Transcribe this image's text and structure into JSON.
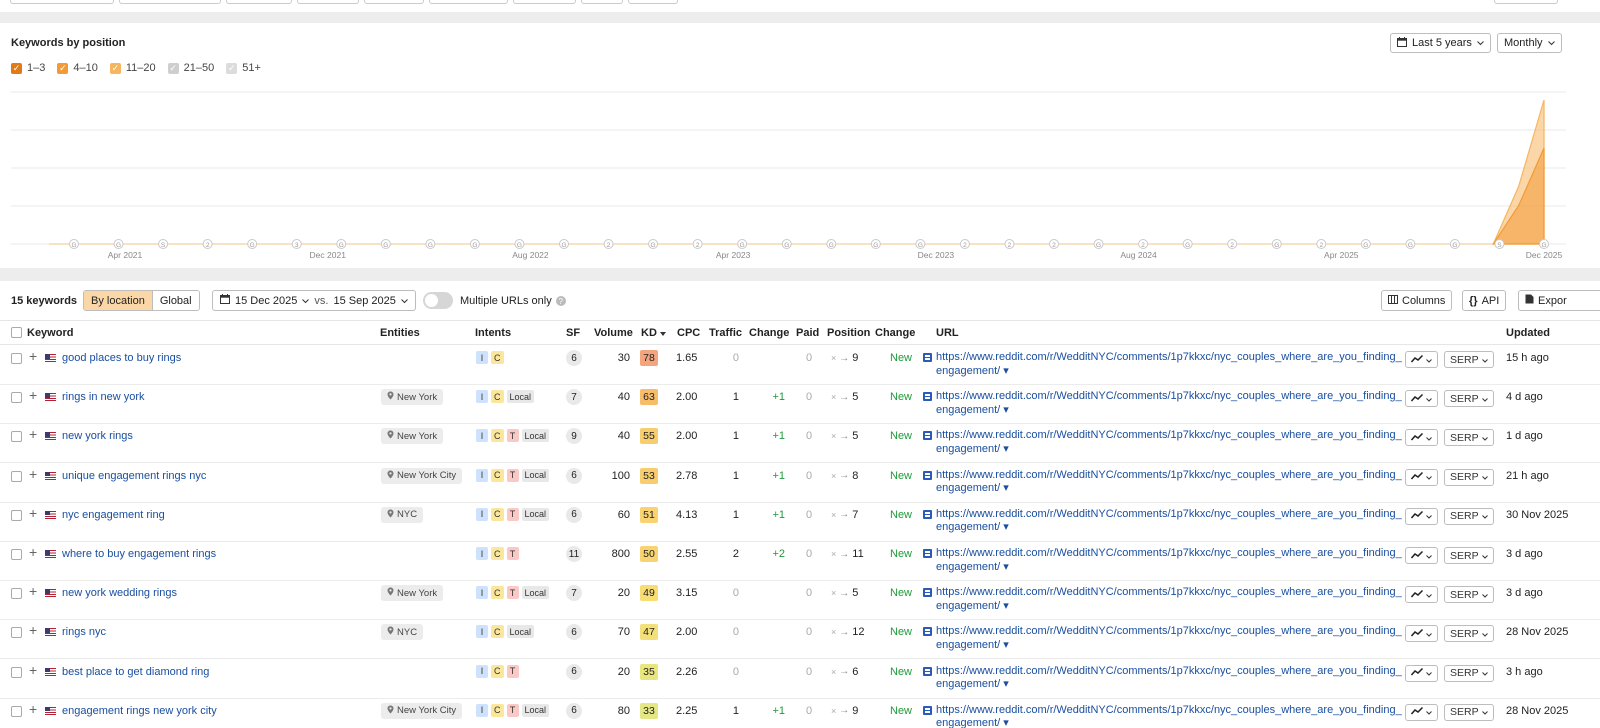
{
  "chart": {
    "title": "Keywords by position",
    "range_label": "Last 5 years",
    "granularity_label": "Monthly",
    "legend": [
      {
        "label": "1–3",
        "checked": true,
        "color": "#e07b18"
      },
      {
        "label": "4–10",
        "checked": true,
        "color": "#f29b34"
      },
      {
        "label": "11–20",
        "checked": true,
        "color": "#f7b560"
      },
      {
        "label": "21–50",
        "checked": true,
        "color": "#cfcfcf"
      },
      {
        "label": "51+",
        "checked": true,
        "color": "#dcdcdc"
      }
    ]
  },
  "chart_data": {
    "type": "area",
    "x_ticks": [
      "Apr 2021",
      "Dec 2021",
      "Aug 2022",
      "Apr 2023",
      "Dec 2023",
      "Aug 2024",
      "Apr 2025",
      "Dec 2025"
    ],
    "series": [
      {
        "name": "11–20",
        "color": "#f7b560",
        "x": [
          "Oct 2025",
          "Nov 2025",
          "Dec 2025"
        ],
        "values": [
          0,
          6,
          15
        ]
      },
      {
        "name": "4–10",
        "color": "#f29b34",
        "x": [
          "Oct 2025",
          "Nov 2025",
          "Dec 2025"
        ],
        "values": [
          0,
          4,
          10
        ]
      }
    ],
    "ylim": [
      0,
      15
    ],
    "grid": true,
    "annotation_markers": [
      "G",
      "G",
      "S",
      "2",
      "G",
      "3",
      "G",
      "G",
      "G",
      "G",
      "G",
      "G",
      "2",
      "G",
      "2",
      "G",
      "G",
      "G",
      "G",
      "G",
      "2",
      "2",
      "2",
      "G",
      "2",
      "G",
      "2",
      "G",
      "2",
      "G",
      "G",
      "G",
      "S",
      "G"
    ]
  },
  "toolbar": {
    "count": "15 keywords",
    "by_location": "By location",
    "global": "Global",
    "date_a": "15 Dec 2025",
    "vs": "vs.",
    "date_b": "15 Sep 2025",
    "multi_urls": "Multiple URLs only",
    "columns": "Columns",
    "api": "API",
    "export": "Expor"
  },
  "headers": {
    "keyword": "Keyword",
    "entities": "Entities",
    "intents": "Intents",
    "sf": "SF",
    "volume": "Volume",
    "kd": "KD",
    "cpc": "CPC",
    "traffic": "Traffic",
    "change": "Change",
    "paid": "Paid",
    "position": "Position",
    "change2": "Change",
    "url": "URL",
    "updated": "Updated"
  },
  "url_line1": "https://www.reddit.com/r/WedditNYC/comments/1p7kkxc/nyc_couples_where_are_you_finding_",
  "url_line2": "engagement/",
  "serp_label": "SERP",
  "rows": [
    {
      "keyword": "good places to buy rings",
      "entity": "",
      "intents": [
        "I",
        "C"
      ],
      "local": false,
      "sf": "6",
      "volume": "30",
      "kd": "78",
      "kd_color": "#f5a57e",
      "cpc": "1.65",
      "traffic": "0",
      "change": "",
      "paid": "0",
      "pos_from": "×",
      "pos_to": "9",
      "status": "New",
      "updated": "15 h ago"
    },
    {
      "keyword": "rings in new york",
      "entity": "New York",
      "intents": [
        "I",
        "C"
      ],
      "local": true,
      "sf": "7",
      "volume": "40",
      "kd": "63",
      "kd_color": "#f7bd68",
      "cpc": "2.00",
      "traffic": "1",
      "change": "+1",
      "paid": "0",
      "pos_from": "×",
      "pos_to": "5",
      "status": "New",
      "updated": "4 d ago"
    },
    {
      "keyword": "new york rings",
      "entity": "New York",
      "intents": [
        "I",
        "C",
        "T"
      ],
      "local": true,
      "sf": "9",
      "volume": "40",
      "kd": "55",
      "kd_color": "#f8cd6e",
      "cpc": "2.00",
      "traffic": "1",
      "change": "+1",
      "paid": "0",
      "pos_from": "×",
      "pos_to": "5",
      "status": "New",
      "updated": "1 d ago"
    },
    {
      "keyword": "unique engagement rings nyc",
      "entity": "New York City",
      "intents": [
        "I",
        "C",
        "T"
      ],
      "local": true,
      "sf": "6",
      "volume": "100",
      "kd": "53",
      "kd_color": "#f8cd6e",
      "cpc": "2.78",
      "traffic": "1",
      "change": "+1",
      "paid": "0",
      "pos_from": "×",
      "pos_to": "8",
      "status": "New",
      "updated": "21 h ago"
    },
    {
      "keyword": "nyc engagement ring",
      "entity": "NYC",
      "intents": [
        "I",
        "C",
        "T"
      ],
      "local": true,
      "sf": "6",
      "volume": "60",
      "kd": "51",
      "kd_color": "#f8d36f",
      "cpc": "4.13",
      "traffic": "1",
      "change": "+1",
      "paid": "0",
      "pos_from": "×",
      "pos_to": "7",
      "status": "New",
      "updated": "30 Nov 2025"
    },
    {
      "keyword": "where to buy engagement rings",
      "entity": "",
      "intents": [
        "I",
        "C",
        "T"
      ],
      "local": false,
      "sf": "11",
      "volume": "800",
      "kd": "50",
      "kd_color": "#f8d36f",
      "cpc": "2.55",
      "traffic": "2",
      "change": "+2",
      "paid": "0",
      "pos_from": "×",
      "pos_to": "11",
      "status": "New",
      "updated": "3 d ago"
    },
    {
      "keyword": "new york wedding rings",
      "entity": "New York",
      "intents": [
        "I",
        "C",
        "T"
      ],
      "local": true,
      "sf": "7",
      "volume": "20",
      "kd": "49",
      "kd_color": "#f7dd74",
      "cpc": "3.15",
      "traffic": "0",
      "change": "",
      "paid": "0",
      "pos_from": "×",
      "pos_to": "5",
      "status": "New",
      "updated": "3 d ago"
    },
    {
      "keyword": "rings nyc",
      "entity": "NYC",
      "intents": [
        "I",
        "C"
      ],
      "local": true,
      "sf": "6",
      "volume": "70",
      "kd": "47",
      "kd_color": "#f4e07a",
      "cpc": "2.00",
      "traffic": "0",
      "change": "",
      "paid": "0",
      "pos_from": "×",
      "pos_to": "12",
      "status": "New",
      "updated": "28 Nov 2025"
    },
    {
      "keyword": "best place to get diamond ring",
      "entity": "",
      "intents": [
        "I",
        "C",
        "T"
      ],
      "local": false,
      "sf": "6",
      "volume": "20",
      "kd": "35",
      "kd_color": "#e9e67e",
      "cpc": "2.26",
      "traffic": "0",
      "change": "",
      "paid": "0",
      "pos_from": "×",
      "pos_to": "6",
      "status": "New",
      "updated": "3 h ago"
    },
    {
      "keyword": "engagement rings new york city",
      "entity": "New York City",
      "intents": [
        "I",
        "C",
        "T"
      ],
      "local": true,
      "sf": "6",
      "volume": "80",
      "kd": "33",
      "kd_color": "#e4e783",
      "cpc": "2.25",
      "traffic": "1",
      "change": "+1",
      "paid": "0",
      "pos_from": "×",
      "pos_to": "9",
      "status": "New",
      "updated": "28 Nov 2025"
    }
  ]
}
